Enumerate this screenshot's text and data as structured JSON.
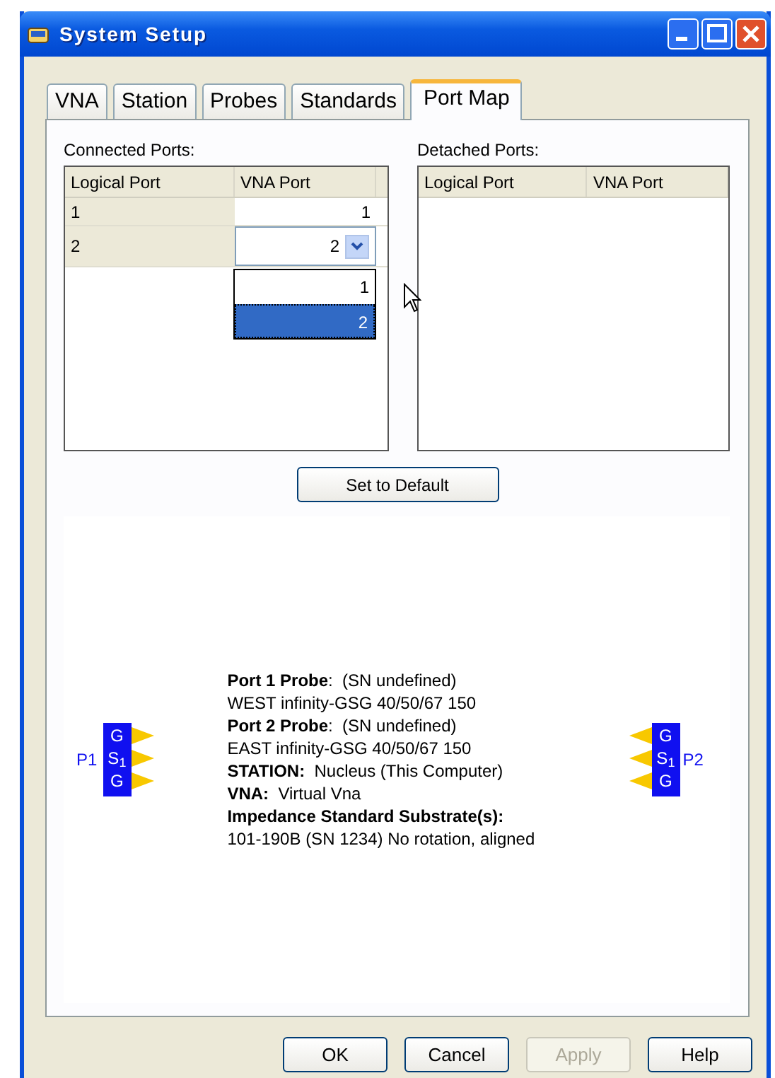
{
  "window": {
    "title": "System Setup"
  },
  "tabs": [
    {
      "label": "VNA",
      "selected": false
    },
    {
      "label": "Station",
      "selected": false
    },
    {
      "label": "Probes",
      "selected": false
    },
    {
      "label": "Standards",
      "selected": false
    },
    {
      "label": "Port Map",
      "selected": true
    }
  ],
  "connected_ports": {
    "label": "Connected Ports:",
    "columns": [
      "Logical Port",
      "VNA Port"
    ],
    "rows": [
      {
        "logical_port": "1",
        "vna_port": "1",
        "editing": false
      },
      {
        "logical_port": "2",
        "vna_port": "2",
        "editing": true
      }
    ],
    "dropdown_options": [
      {
        "label": "1",
        "selected": false
      },
      {
        "label": "2",
        "selected": true
      }
    ]
  },
  "detached_ports": {
    "label": "Detached Ports:",
    "columns": [
      "Logical Port",
      "VNA Port"
    ]
  },
  "set_default_button": "Set to Default",
  "diagram": {
    "left_probe": {
      "label": "P1",
      "contacts": [
        "G",
        "S$_{1}$",
        "G"
      ]
    },
    "right_probe": {
      "label": "P2",
      "contacts": [
        "G",
        "S$_{1}$",
        "G"
      ]
    },
    "info_lines": [
      {
        "kind": "field",
        "text": "**Port 1 Probe**:  (SN undefined)"
      },
      {
        "kind": "plain",
        "text": "WEST infinity-GSG 40/50/67 150"
      },
      {
        "kind": "field",
        "text": "**Port 2 Probe**:  (SN undefined)"
      },
      {
        "kind": "plain",
        "text": "EAST infinity-GSG 40/50/67 150"
      },
      {
        "kind": "field",
        "text": "**STATION:**  Nucleus (This Computer)"
      },
      {
        "kind": "field",
        "text": "**VNA:**  Virtual Vna"
      },
      {
        "kind": "heading",
        "text": "Impedance Standard Substrate(s):"
      },
      {
        "kind": "plain",
        "text": "101-190B (SN 1234) No rotation, aligned"
      }
    ]
  },
  "buttons": [
    {
      "label": "OK",
      "disabled": false
    },
    {
      "label": "Cancel",
      "disabled": false
    },
    {
      "label": "Apply",
      "disabled": true
    },
    {
      "label": "Help",
      "disabled": false
    }
  ]
}
